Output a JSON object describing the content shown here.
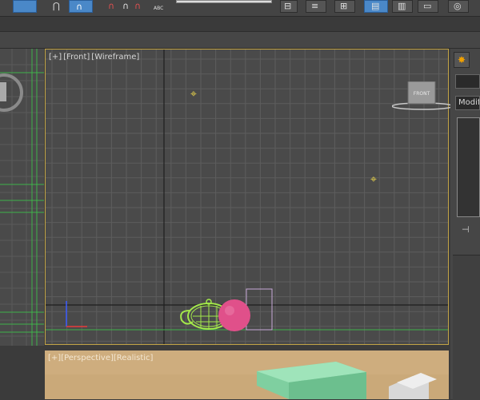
{
  "toolbar": {
    "buttons": [
      {
        "name": "select-object-icon",
        "glyph": "▣"
      },
      {
        "name": "snaps-toggle-icon",
        "glyph": "⋂"
      },
      {
        "name": "angle-snap-icon",
        "glyph": "∩"
      },
      {
        "name": "percent-snap-icon",
        "glyph": "∩"
      },
      {
        "name": "spinner-snap-icon",
        "glyph": "∩"
      },
      {
        "name": "edit-named-selection-icon",
        "glyph": "ABC"
      }
    ],
    "abc_label": "ABC"
  },
  "front_viewport": {
    "label_plus": "[+]",
    "label_view": "[Front]",
    "label_shading": "[Wireframe]",
    "viewcube_label": "FRONT"
  },
  "perspective_viewport": {
    "label_plus": "[+]",
    "label_view": "[Perspective]",
    "label_shading": "[Realistic]"
  },
  "command_panel": {
    "modifier_list_label": "Modifier List",
    "tab_icon": "sun-icon"
  },
  "colors": {
    "viewport_bg": "#4a4a4a",
    "active_border": "#c2a446",
    "teapot": "#a3e84a",
    "sphere": "#e0508a",
    "ground": "#c9a877"
  }
}
